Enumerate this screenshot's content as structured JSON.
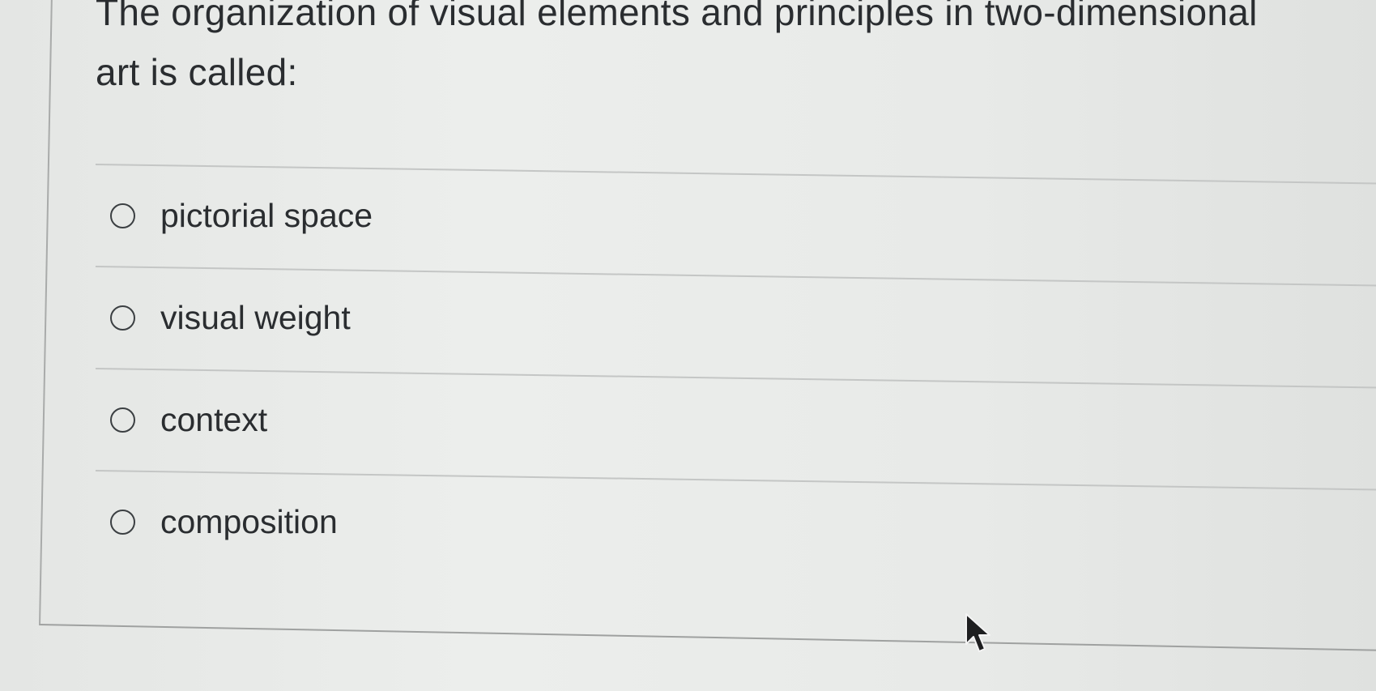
{
  "question": {
    "text": "The organization of visual elements and principles in two-dimensional art is called:"
  },
  "choices": [
    {
      "label": "pictorial space",
      "selected": false
    },
    {
      "label": "visual weight",
      "selected": false
    },
    {
      "label": "context",
      "selected": false
    },
    {
      "label": "composition",
      "selected": false
    }
  ],
  "icons": {
    "radio": "radio-button-icon",
    "cursor": "mouse-pointer-icon"
  },
  "colors": {
    "text": "#2a2d30",
    "radio_border": "#3b3f42",
    "divider": "#c4c6c5",
    "background": "#e9ebe9"
  }
}
